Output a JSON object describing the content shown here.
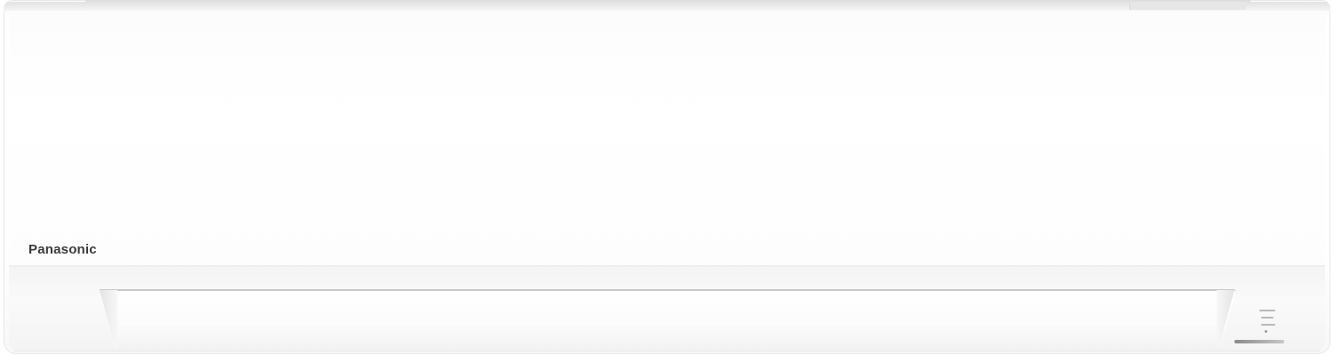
{
  "product": {
    "brand_label": "Panasonic"
  },
  "colors": {
    "body": "#ffffff",
    "logo": "#3a3a3a",
    "trim": "#d0d0d0"
  },
  "icons": {
    "indicator_lamps": "indicator-lamps-icon",
    "remote_sensor": "sensor-window-icon"
  }
}
